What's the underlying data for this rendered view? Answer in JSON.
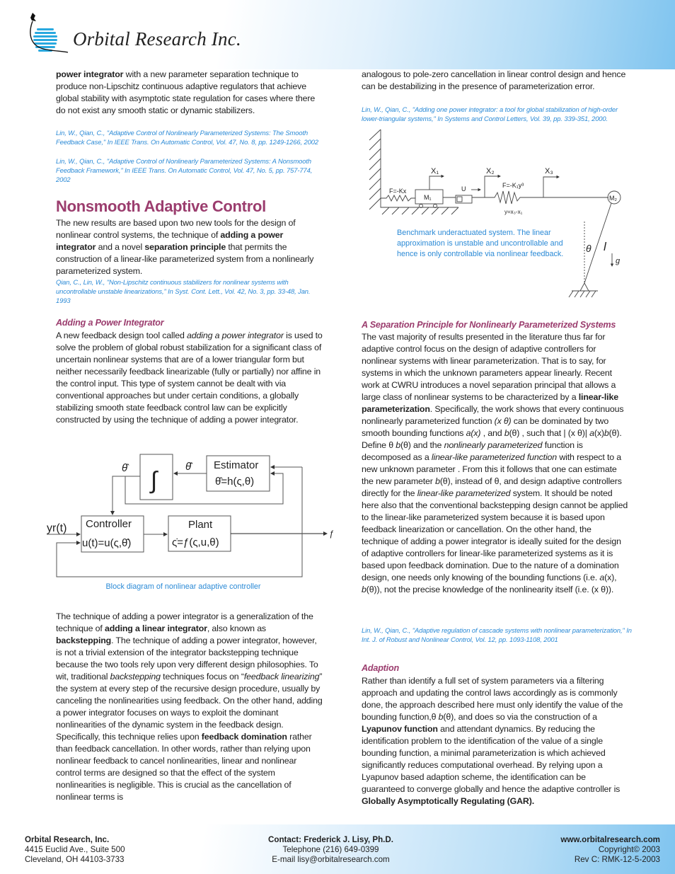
{
  "header": {
    "company_logo_text": "Orbital Research Inc.",
    "accent_color": "#7fc4ef"
  },
  "left": {
    "intro": [
      {
        "t": "power integrator",
        "s": "b"
      },
      {
        "t": " with a new parameter separation technique to produce non-Lipschitz continuous adaptive regulators that achieve global stability with asymptotic state regulation for cases where there do not exist any smooth static or dynamic stabilizers."
      }
    ],
    "ref1": "Lin, W., Qian, C., \"Adaptive Control of Nonlinearly Parameterized Systems: The Smooth Feedback Case,\" In IEEE Trans. On Automatic Control, Vol. 47, No. 8, pp. 1249-1266, 2002",
    "ref2": "Lin, W., Qian, C., \"Adaptive Control of Nonlinearly Parameterized Systems: A Nonsmooth Feedback Framework,\" In IEEE Trans. On Automatic Control, Vol. 47, No. 5, pp. 757-774, 2002",
    "section_title": "Nonsmooth Adaptive Control",
    "section_para": [
      {
        "t": "The new results are based upon two new tools for the design of nonlinear control systems, the technique of "
      },
      {
        "t": "adding a power integrator",
        "s": "b"
      },
      {
        "t": " and a novel "
      },
      {
        "t": "separation principle",
        "s": "b"
      },
      {
        "t": " that permits the construction of a linear-like parameterized system from a nonlinearly parameterized system."
      }
    ],
    "ref3": "Qian, C., Lin, W., \"Non-Lipschitz continuous stabilizers for nonlinear systems with uncontrollable unstable linearizations,\" In Syst. Cont. Lett., Vol. 42, No. 3, pp. 33-48, Jan. 1993",
    "subheading": "Adding a Power Integrator",
    "power_para": [
      {
        "t": "A new feedback design tool called "
      },
      {
        "t": "adding a power integrator",
        "s": "i"
      },
      {
        "t": " is used to solve the problem of global robust stabilization for a significant class of uncertain nonlinear systems that are of a lower triangular form but neither necessarily feedback linearizable (fully or partially) nor affine in the control input.  This type of system cannot be dealt with via conventional approaches but under certain conditions, a globally stabilizing smooth state feedback control law can be explicitly constructed by using the technique of adding a power integrator."
      }
    ],
    "block_diagram": {
      "theta_hat": "θ̂",
      "theta_hat_dot": "θ̂̇",
      "integral": "∫",
      "estimator_title": "Estimator",
      "estimator_eq": "θ̂=h(ς,θ)",
      "controller_title": "Controller",
      "controller_eq": "u(t)=u(ς,θ̂)",
      "plant_title": "Plant",
      "plant_eq": "ς̇=ƒ(ς,u,θ)",
      "input": "yr(t)",
      "output": "ƒ",
      "caption": "Block diagram of nonlinear adaptive controller"
    },
    "technique_para": [
      {
        "t": "The technique of adding a power integrator is a generalization of the technique of "
      },
      {
        "t": "adding a linear integrator",
        "s": "b"
      },
      {
        "t": ", also known as "
      },
      {
        "t": "backstepping",
        "s": "b"
      },
      {
        "t": ".  The technique of adding a power integrator, however, is not a trivial extension of the integrator backstepping technique because the two tools rely upon very different design philosophies.  To wit, traditional "
      },
      {
        "t": "backstepping",
        "s": "i"
      },
      {
        "t": " techniques focus on “"
      },
      {
        "t": "feedback linearizing",
        "s": "i"
      },
      {
        "t": "” the system at every step of the recursive design procedure, usually by canceling the nonlinearities using feedback.  On the other hand, adding a power integrator focuses on ways to exploit the dominant nonlinearities of the dynamic system in the feedback design.  Specifically, this technique relies upon "
      },
      {
        "t": "feedback domination",
        "s": "b"
      },
      {
        "t": " rather than feedback cancellation.  In other words, rather than relying upon nonlinear feedback to cancel nonlinearities, linear and nonlinear control terms are designed so that the effect of the system nonlinearities is negligible.  This is crucial as the cancellation of nonlinear terms is"
      }
    ]
  },
  "right": {
    "intro": [
      {
        "t": "analogous to pole-zero cancellation in linear control design and hence can be destabilizing in the presence of parameterization error."
      }
    ],
    "ref1": "Lin, W., Qian, C., \"Adding one power integrator: a tool for global stabilization of high-order lower-triangular systems,\" In Systems and Control Letters, Vol. 39, pp. 339-351, 2000.",
    "benchmark": {
      "x1": "X₁",
      "x2": "X₂",
      "x3": "X₃",
      "spring1": "F=-Kx",
      "m1": "M₁",
      "u": "U",
      "spring2": "F=-K₁y³",
      "y_eq": "y=x₃-x₁",
      "m2": "M₂",
      "theta": "θ",
      "l": "l",
      "g": "g",
      "caption": "Benchmark underactuated system. The linear approximation is unstable and uncontrollable and hence is only controllable via nonlinear feedback."
    },
    "sep_title": "A Separation Principle for Nonlinearly Parameterized Systems",
    "sep_para": [
      {
        "t": "The vast majority of results presented in the literature thus far for adaptive control focus on the design of adaptive controllers for nonlinear systems with linear parameterization.  That is to say, for systems in which the unknown parameters appear linearly.  Recent work at CWRU introduces a novel separation principal that allows a large class of nonlinear systems to be characterized by a "
      },
      {
        "t": "linear-like parameterization",
        "s": "b"
      },
      {
        "t": ".  Specifically, the work shows that every continuous nonlinearly parameterized function   "
      },
      {
        "t": "(x θ)",
        "s": "i"
      },
      {
        "t": " can be dominated by two smooth bounding functions "
      },
      {
        "t": "a(x)",
        "s": "i"
      },
      {
        "t": "      , and "
      },
      {
        "t": "b",
        "s": "i"
      },
      {
        "t": "(θ)   , such that |    (x θ)|    "
      },
      {
        "t": "a",
        "s": "i"
      },
      {
        "t": "(x)"
      },
      {
        "t": "b",
        "s": "i"
      },
      {
        "t": "(θ).  Define θ  "
      },
      {
        "t": "b",
        "s": "i"
      },
      {
        "t": "(θ) and the "
      },
      {
        "t": "nonlinearly parameterized",
        "s": "i"
      },
      {
        "t": " function is decomposed as a "
      },
      {
        "t": "linear-like parameterized function",
        "s": "i"
      },
      {
        "t": " with respect to a new unknown parameter   .  From this it follows that one can estimate the new parameter     "
      },
      {
        "t": "b",
        "s": "i"
      },
      {
        "t": "(θ), instead of θ, and design adaptive controllers directly for the "
      },
      {
        "t": "linear-like parameterized",
        "s": "i"
      },
      {
        "t": " system.  It should be noted here also that the conventional backstepping design cannot be applied to the linear-like parameterized system because it is based upon feedback linearization or cancellation.  On the other hand, the technique of adding a power integrator is ideally suited for the design of adaptive controllers for linear-like parameterized systems as it is based upon feedback domination.  Due to the nature of a domination design, one needs only knowing of  the bounding functions (i.e. "
      },
      {
        "t": "a",
        "s": "i"
      },
      {
        "t": "(x), "
      },
      {
        "t": "b",
        "s": "i"
      },
      {
        "t": "(θ)),  not the precise knowledge of the nonlinearity itself (i.e.    (x θ))."
      }
    ],
    "ref2": "Lin, W., Qian, C., \"Adaptive regulation of cascade systems with nonlinear parameterization,\" In Int. J. of Robust and Nonlinear Control, Vol. 12, pp. 1093-1108, 2001",
    "adaption_title": "Adaption",
    "adaption_para": [
      {
        "t": "Rather than identify a full set of system parameters via a filtering approach and updating the control laws accordingly as is commonly done, the approach described here must only identify the value of the bounding function,θ  "
      },
      {
        "t": "b",
        "s": "i"
      },
      {
        "t": "(θ), and does so via the construction of a "
      },
      {
        "t": "Lyapunov function",
        "s": "b"
      },
      {
        "t": " and attendant dynamics.  By reducing the identification problem to the identification of the value of a single bounding function, a minimal parameterization is which achieved significantly reduces computational overhead.  By relying upon a Lyapunov based adaption scheme, the identification can be guaranteed to converge globally and hence the adaptive controller is "
      },
      {
        "t": "Globally Asymptotically Regulating (GAR).",
        "s": "b"
      }
    ]
  },
  "footer": {
    "company": "Orbital Research, Inc.",
    "address1": "4415 Euclid Ave., Suite 500",
    "address2": "Cleveland, OH 44103-3733",
    "contact": "Contact: Frederick J. Lisy, Ph.D.",
    "phone": "Telephone (216) 649-0399",
    "email": "E-mail lisy@orbitalresearch.com",
    "website": "www.orbitalresearch.com",
    "copyright": "Copyright© 2003",
    "revision": "Rev C: RMK-12-5-2003"
  }
}
